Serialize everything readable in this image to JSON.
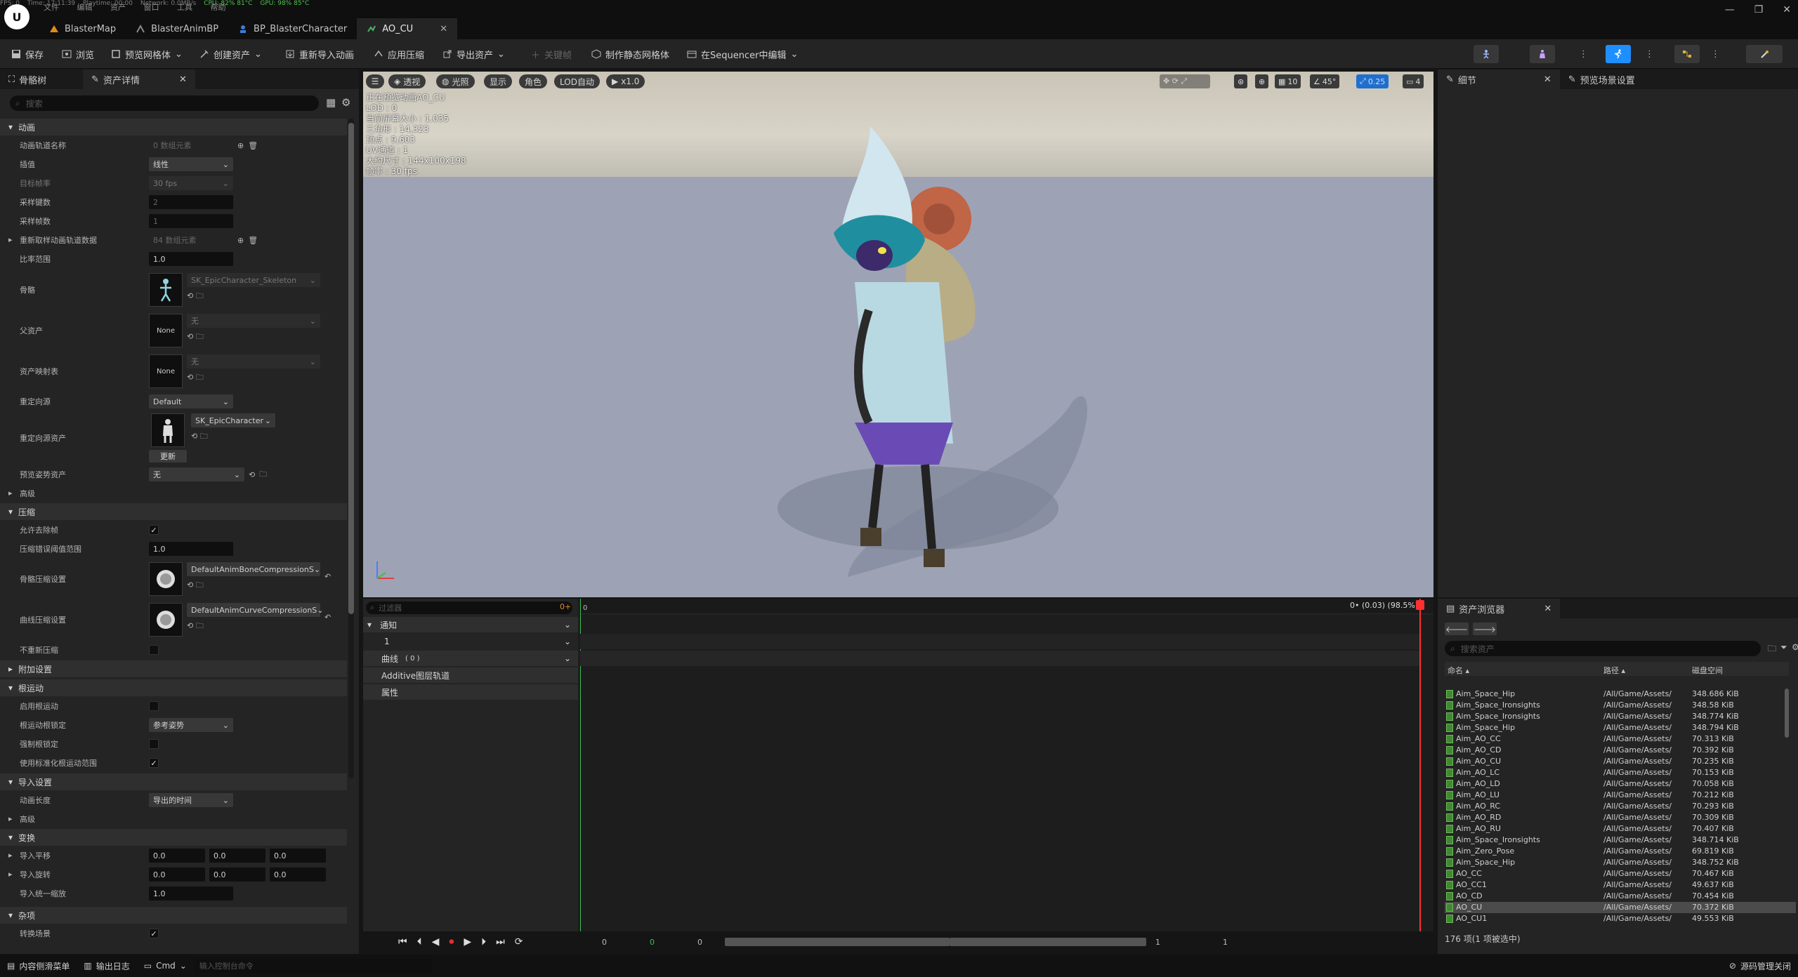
{
  "stats": {
    "fps": "FPS: 0",
    "time": "Time: 17:11:39",
    "playtime": "Playtime: 00:00",
    "network": "Network: 0.0MB/s",
    "cpu": "CPU: 82%  81°C",
    "gpu": "GPU: 98%  85°C"
  },
  "menu": [
    "文件",
    "编辑",
    "资产",
    "窗口",
    "工具",
    "帮助"
  ],
  "tabs": [
    {
      "label": "BlasterMap",
      "active": false
    },
    {
      "label": "BlasterAnimBP",
      "active": false
    },
    {
      "label": "BP_BlasterCharacter",
      "active": false
    },
    {
      "label": "AO_CU",
      "active": true
    }
  ],
  "toolbar": {
    "save": "保存",
    "browse": "浏览",
    "preview_mesh": "预览网格体",
    "create_asset": "创建资产",
    "reimport": "重新导入动画",
    "apply_compression": "应用压缩",
    "export_asset": "导出资产",
    "key": "关键帧",
    "make_static_mesh": "制作静态网格体",
    "edit_in_sequencer": "在Sequencer中编辑"
  },
  "left_panel": {
    "tab_skeleton": "骨骼树",
    "tab_details": "资产详情",
    "search_placeholder": "搜索",
    "sections": {
      "animation": "动画",
      "compression": "压缩",
      "additional": "附加设置",
      "root_motion": "根运动",
      "import": "导入设置",
      "transform": "变换",
      "misc": "杂项",
      "advanced": "高级",
      "advanced2": "高级"
    },
    "props": {
      "track_names": "动画轨道名称",
      "track_names_val": "0 数组元素",
      "interp": "插值",
      "interp_val": "线性",
      "target_fps": "目标帧率",
      "target_fps_val": "30 fps",
      "sample_keys": "采样键数",
      "sample_keys_val": "2",
      "sample_frames": "采样帧数",
      "sample_frames_val": "1",
      "resample": "重新取样动画轨道数据",
      "resample_val": "84 数组元素",
      "rate_scale": "比率范围",
      "rate_scale_val": "1.0",
      "skeleton": "骨骼",
      "skeleton_val": "SK_EpicCharacter_Skeleton",
      "parent": "父资产",
      "parent_val": "无",
      "none": "None",
      "asset_map": "资产映射表",
      "asset_map_val": "无",
      "retarget": "重定向源",
      "retarget_val": "Default",
      "retarget_asset": "重定向源资产",
      "retarget_asset_val": "SK_EpicCharacter",
      "update": "更新",
      "preview_pose": "预览姿势资产",
      "preview_pose_val": "无",
      "allow_strip": "允许去除帧",
      "err_threshold": "压缩错误阈值范围",
      "err_threshold_val": "1.0",
      "bone_comp": "骨骼压缩设置",
      "bone_comp_val": "DefaultAnimBoneCompressionS",
      "curve_comp": "曲线压缩设置",
      "curve_comp_val": "DefaultAnimCurveCompressionS",
      "no_recompress": "不重新压缩",
      "enable_root": "启用根运动",
      "root_lock": "根运动根锁定",
      "root_lock_val": "参考姿势",
      "force_root_lock": "强制根锁定",
      "normalized_root": "使用标准化根运动范围",
      "anim_length": "动画长度",
      "anim_length_val": "导出的时间",
      "import_translation": "导入平移",
      "import_rotation": "导入旋转",
      "import_scale": "导入统一缩放",
      "vec_val": "0.0",
      "scale_val": "1.0",
      "convert_scene": "转换场景"
    }
  },
  "viewport": {
    "perspective": "透视",
    "lit": "光照",
    "show": "显示",
    "character": "角色",
    "lod": "LOD自动",
    "speed": "x1.0",
    "grid": "10",
    "angle": "45°",
    "scale": "0.25",
    "cam": "4",
    "info": [
      "正在预览动画AO_CU",
      "LOD : 0",
      "当前屏幕大小 : 1.035",
      "三角形 : 14,323",
      "顶点 : 9,603",
      "UV通道 : 1",
      "大约尺寸 : 144x100x198",
      "帧率 : 30 fps"
    ]
  },
  "right_panel": {
    "details": "细节",
    "preview_settings": "预览场景设置"
  },
  "timeline": {
    "filter_placeholder": "过滤器",
    "notifies": "通知",
    "notify_track": "1",
    "curves": "曲线",
    "curves_count": "( 0 )",
    "additive": "Additive图层轨道",
    "attributes": "属性",
    "frame_readout": "0• (0.03) (98.5%)",
    "start": "0",
    "start2": "0",
    "start3": "0",
    "end": "1",
    "end2": "1",
    "frame0": "0"
  },
  "content_browser": {
    "title": "资产浏览器",
    "search_placeholder": "搜索资产",
    "col_name": "命名",
    "col_path": "路径",
    "col_size": "磁盘空间",
    "items": [
      {
        "name": "Aim_Space_Hip",
        "path": "/All/Game/Assets/",
        "size": "348.686 KiB"
      },
      {
        "name": "Aim_Space_Ironsights",
        "path": "/All/Game/Assets/",
        "size": "348.58 KiB"
      },
      {
        "name": "Aim_Space_Ironsights",
        "path": "/All/Game/Assets/",
        "size": "348.774 KiB"
      },
      {
        "name": "Aim_Space_Hip",
        "path": "/All/Game/Assets/",
        "size": "348.794 KiB"
      },
      {
        "name": "Aim_AO_CC",
        "path": "/All/Game/Assets/",
        "size": "70.313 KiB"
      },
      {
        "name": "Aim_AO_CD",
        "path": "/All/Game/Assets/",
        "size": "70.392 KiB"
      },
      {
        "name": "Aim_AO_CU",
        "path": "/All/Game/Assets/",
        "size": "70.235 KiB"
      },
      {
        "name": "Aim_AO_LC",
        "path": "/All/Game/Assets/",
        "size": "70.153 KiB"
      },
      {
        "name": "Aim_AO_LD",
        "path": "/All/Game/Assets/",
        "size": "70.058 KiB"
      },
      {
        "name": "Aim_AO_LU",
        "path": "/All/Game/Assets/",
        "size": "70.212 KiB"
      },
      {
        "name": "Aim_AO_RC",
        "path": "/All/Game/Assets/",
        "size": "70.293 KiB"
      },
      {
        "name": "Aim_AO_RD",
        "path": "/All/Game/Assets/",
        "size": "70.309 KiB"
      },
      {
        "name": "Aim_AO_RU",
        "path": "/All/Game/Assets/",
        "size": "70.407 KiB"
      },
      {
        "name": "Aim_Space_Ironsights",
        "path": "/All/Game/Assets/",
        "size": "348.714 KiB"
      },
      {
        "name": "Aim_Zero_Pose",
        "path": "/All/Game/Assets/",
        "size": "69.819 KiB"
      },
      {
        "name": "Aim_Space_Hip",
        "path": "/All/Game/Assets/",
        "size": "348.752 KiB"
      },
      {
        "name": "AO_CC",
        "path": "/All/Game/Assets/",
        "size": "70.467 KiB"
      },
      {
        "name": "AO_CC1",
        "path": "/All/Game/Assets/",
        "size": "49.637 KiB"
      },
      {
        "name": "AO_CD",
        "path": "/All/Game/Assets/",
        "size": "70.454 KiB"
      },
      {
        "name": "AO_CU",
        "path": "/All/Game/Assets/",
        "size": "70.372 KiB",
        "selected": true
      },
      {
        "name": "AO_CU1",
        "path": "/All/Game/Assets/",
        "size": "49.553 KiB"
      }
    ],
    "count": "176 项(1 项被选中)"
  },
  "statusbar": {
    "drawer": "内容侧滑菜单",
    "log": "输出日志",
    "cmd": "Cmd",
    "cmd_placeholder": "输入控制台命令",
    "source": "源码管理关闭"
  },
  "colors": {
    "accent": "#1e8fff",
    "panel": "#242424",
    "bg": "#151515",
    "selection": "#4b4b4b"
  }
}
